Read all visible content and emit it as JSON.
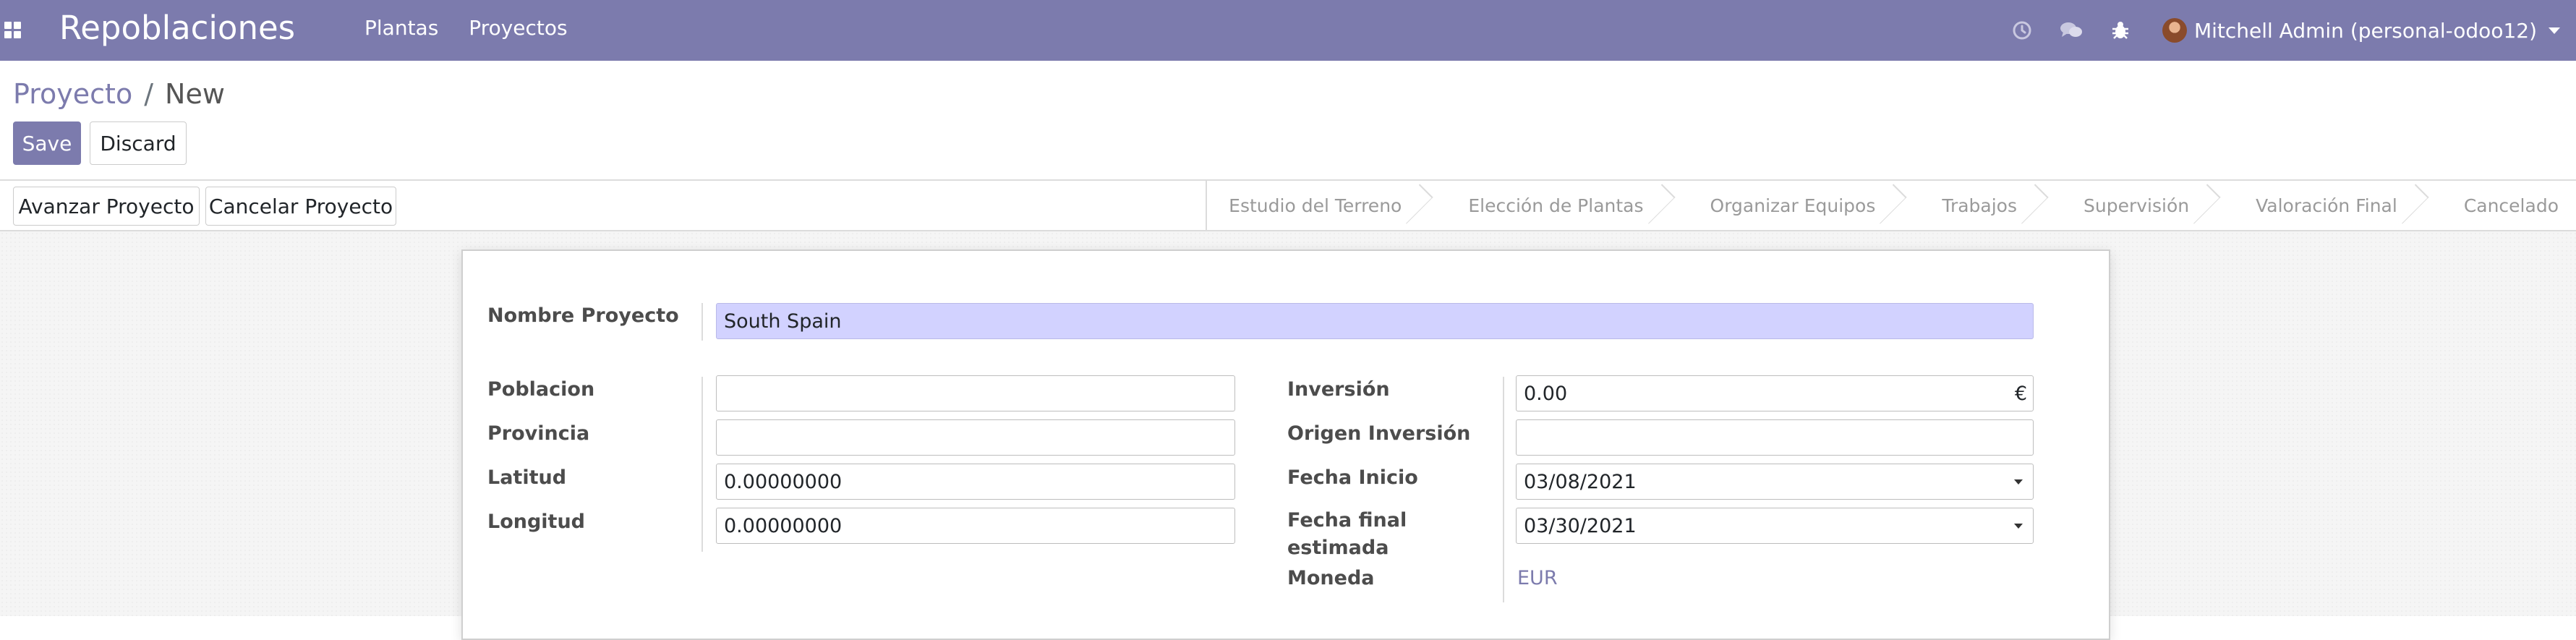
{
  "navbar": {
    "app_title": "Repoblaciones",
    "menu": [
      "Plantas",
      "Proyectos"
    ],
    "icons": [
      "clock-icon",
      "chat-icon",
      "bug-icon"
    ],
    "user": "Mitchell Admin (personal-odoo12)"
  },
  "breadcrumb": {
    "parent": "Proyecto",
    "separator": "/",
    "current": "New"
  },
  "buttons": {
    "save": "Save",
    "discard": "Discard",
    "advance": "Avanzar Proyecto",
    "cancel_project": "Cancelar Proyecto"
  },
  "stages": [
    "Estudio del Terreno",
    "Elección de Plantas",
    "Organizar Equipos",
    "Trabajos",
    "Supervisión",
    "Valoración Final",
    "Cancelado"
  ],
  "form": {
    "nombre_label": "Nombre Proyecto",
    "nombre_value": "South Spain",
    "poblacion_label": "Poblacion",
    "poblacion_value": "",
    "provincia_label": "Provincia",
    "provincia_value": "",
    "latitud_label": "Latitud",
    "latitud_value": "0.00000000",
    "longitud_label": "Longitud",
    "longitud_value": "0.00000000",
    "inversion_label": "Inversión",
    "inversion_value": "0.00",
    "inversion_currency": "€",
    "origen_label": "Origen Inversión",
    "origen_value": "",
    "fecha_inicio_label": "Fecha Inicio",
    "fecha_inicio_value": "03/08/2021",
    "fecha_final_label": "Fecha final estimada",
    "fecha_final_value": "03/30/2021",
    "moneda_label": "Moneda",
    "moneda_value": "EUR"
  },
  "colors": {
    "brand": "#7c7bad",
    "required_field": "#d2d2ff"
  }
}
